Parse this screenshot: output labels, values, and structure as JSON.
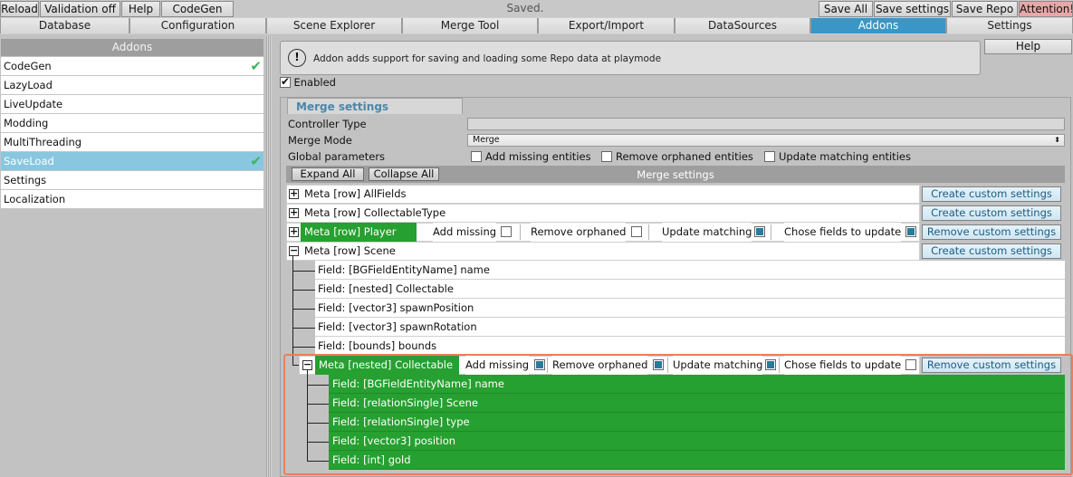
{
  "toolbar": {
    "reload": "Reload",
    "validation": "Validation off",
    "help": "Help",
    "codegen": "CodeGen",
    "status": "Saved.",
    "save_all": "Save All",
    "save_settings": "Save settings",
    "save_repo": "Save Repo",
    "attention": "Attention!"
  },
  "tabs": [
    "Database",
    "Configuration",
    "Scene Explorer",
    "Merge Tool",
    "Export/Import",
    "DataSources",
    "Addons",
    "Settings"
  ],
  "active_tab": "Addons",
  "sidebar": {
    "header": "Addons",
    "items": [
      {
        "label": "CodeGen",
        "checked": true
      },
      {
        "label": "LazyLoad",
        "checked": false
      },
      {
        "label": "LiveUpdate",
        "checked": false
      },
      {
        "label": "Modding",
        "checked": false
      },
      {
        "label": "MultiThreading",
        "checked": false
      },
      {
        "label": "SaveLoad",
        "checked": true,
        "selected": true
      },
      {
        "label": "Settings",
        "checked": false
      },
      {
        "label": "Localization",
        "checked": false
      }
    ]
  },
  "main": {
    "help": "Help",
    "info_text": "Addon adds support for saving and loading some Repo data at playmode",
    "enabled_label": "Enabled",
    "enabled": true,
    "merge_tab": "Merge settings",
    "controller_type_label": "Controller Type",
    "controller_type_value": "",
    "merge_mode_label": "Merge Mode",
    "merge_mode_value": "Merge",
    "global_params_label": "Global parameters",
    "global_params": {
      "add_missing": "Add missing entities",
      "remove_orphaned": "Remove orphaned entities",
      "update_matching": "Update matching entities"
    },
    "expand_all": "Expand All",
    "collapse_all": "Collapse All",
    "table_title": "Merge settings",
    "create_custom": "Create custom settings",
    "remove_custom": "Remove custom settings",
    "opt_add_missing": "Add missing",
    "opt_remove_orphaned": "Remove orphaned",
    "opt_update_matching": "Update matching",
    "opt_chose_fields": "Chose fields to update",
    "metas": {
      "allfields": "Meta [row] AllFields",
      "collectabletype": "Meta [row] CollectableType",
      "player": "Meta [row] Player",
      "scene": "Meta [row] Scene",
      "collectable": "Meta [nested] Collectable"
    },
    "scene_fields": [
      "Field: [BGFieldEntityName] name",
      "Field: [nested] Collectable",
      "Field: [vector3] spawnPosition",
      "Field: [vector3] spawnRotation",
      "Field: [bounds] bounds"
    ],
    "collectable_fields": [
      "Field: [BGFieldEntityName] name",
      "Field: [relationSingle] Scene",
      "Field: [relationSingle] type",
      "Field: [vector3] position",
      "Field: [int] gold"
    ]
  }
}
